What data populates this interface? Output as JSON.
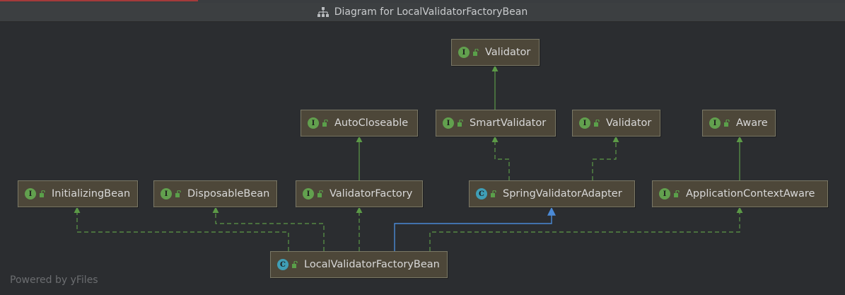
{
  "window": {
    "title": "Diagram for LocalValidatorFactoryBean",
    "title_icon": "hierarchy-icon"
  },
  "colors": {
    "background": "#2b2d30",
    "node_fill": "#4d4739",
    "node_border": "#7a7866",
    "interface_badge": "#62a04e",
    "class_badge": "#3f9eb6",
    "extends_edge": "#5c9a47",
    "implements_edge": "#4b8ad6"
  },
  "nodes": {
    "validator_top": {
      "kind": "I",
      "label": "Validator"
    },
    "auto_closeable": {
      "kind": "I",
      "label": "AutoCloseable"
    },
    "smart_validator": {
      "kind": "I",
      "label": "SmartValidator"
    },
    "validator_mid": {
      "kind": "I",
      "label": "Validator"
    },
    "aware": {
      "kind": "I",
      "label": "Aware"
    },
    "initializing_bean": {
      "kind": "I",
      "label": "InitializingBean"
    },
    "disposable_bean": {
      "kind": "I",
      "label": "DisposableBean"
    },
    "validator_factory": {
      "kind": "I",
      "label": "ValidatorFactory"
    },
    "spring_validator_adapter": {
      "kind": "C",
      "label": "SpringValidatorAdapter"
    },
    "application_context_aware": {
      "kind": "I",
      "label": "ApplicationContextAware"
    },
    "local_validator_factory_bean": {
      "kind": "C",
      "label": "LocalValidatorFactoryBean"
    }
  },
  "footer": {
    "text": "Powered by yFiles"
  }
}
